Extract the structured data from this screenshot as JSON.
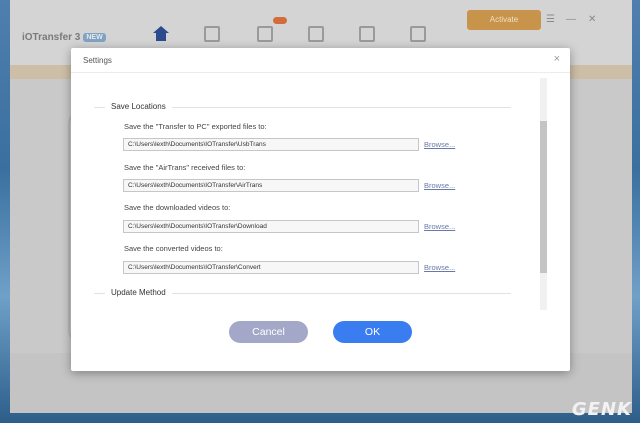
{
  "app": {
    "title": "iOTransfer 3",
    "badge": "NEW",
    "activate_label": "Activate",
    "window_buttons": [
      "☰",
      "—",
      "✕"
    ]
  },
  "dialog": {
    "title": "Settings",
    "close_glyph": "×",
    "sections": {
      "save_locations": "Save Locations",
      "update_method": "Update Method"
    },
    "rows": [
      {
        "label": "Save the \"Transfer to PC\" exported files to:",
        "path": "C:\\Users\\lexth\\Documents\\IOTransfer\\UsbTrans",
        "browse": "Browse..."
      },
      {
        "label": "Save the \"AirTrans\" received files to:",
        "path": "C:\\Users\\lexth\\Documents\\IOTransfer\\AirTrans",
        "browse": "Browse..."
      },
      {
        "label": "Save the downloaded videos to:",
        "path": "C:\\Users\\lexth\\Documents\\IOTransfer\\Download",
        "browse": "Browse..."
      },
      {
        "label": "Save the converted videos to:",
        "path": "C:\\Users\\lexth\\Documents\\IOTransfer\\Convert",
        "browse": "Browse..."
      }
    ],
    "buttons": {
      "cancel": "Cancel",
      "ok": "OK"
    }
  },
  "colors": {
    "ok": "#3a7df0",
    "cancel": "#a3a8c9",
    "link": "#6a7aa8"
  },
  "watermark": "GENK"
}
